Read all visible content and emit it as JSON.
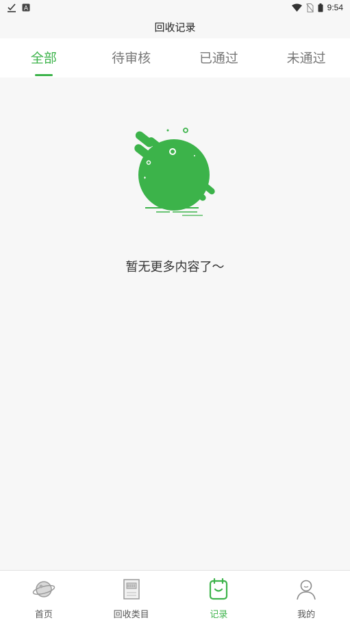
{
  "status_bar": {
    "time": "9:54",
    "icons_left": [
      "download-check-icon",
      "app-a-icon"
    ],
    "icons_right": [
      "wifi-icon",
      "no-sim-icon",
      "battery-icon"
    ]
  },
  "header": {
    "title": "回收记录"
  },
  "tabs": [
    {
      "label": "全部",
      "active": true
    },
    {
      "label": "待审核",
      "active": false
    },
    {
      "label": "已通过",
      "active": false
    },
    {
      "label": "未通过",
      "active": false
    }
  ],
  "empty_state": {
    "message": "暂无更多内容了～",
    "illustration": "green-blob-planet-icon"
  },
  "bottom_nav": [
    {
      "label": "首页",
      "icon": "planet-icon",
      "active": false
    },
    {
      "label": "回收类目",
      "icon": "category-box-icon",
      "active": false
    },
    {
      "label": "记录",
      "icon": "record-clipboard-icon",
      "active": true
    },
    {
      "label": "我的",
      "icon": "user-icon",
      "active": false
    }
  ],
  "colors": {
    "accent": "#3cb34a",
    "background": "#f7f7f7",
    "inactive_text": "#777777"
  }
}
